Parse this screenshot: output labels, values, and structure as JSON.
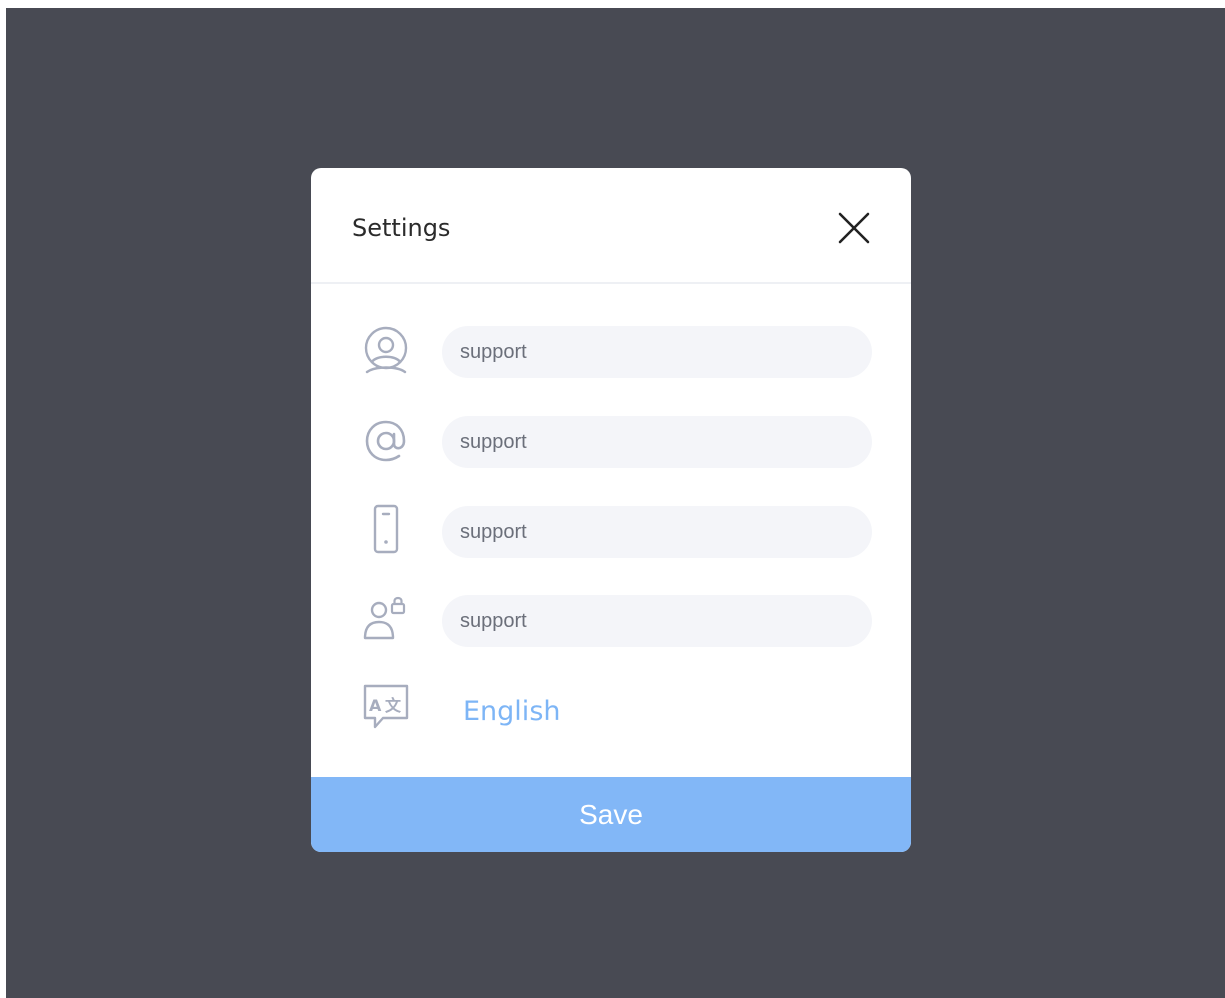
{
  "dialog": {
    "title": "Settings",
    "close_icon": "close-icon"
  },
  "fields": [
    {
      "icon": "user-icon",
      "value": "support"
    },
    {
      "icon": "at-sign-icon",
      "value": "support"
    },
    {
      "icon": "mobile-phone-icon",
      "value": "support"
    },
    {
      "icon": "user-lock-icon",
      "value": "support"
    }
  ],
  "language": {
    "icon": "translate-icon",
    "label": "English"
  },
  "actions": {
    "save_label": "Save"
  },
  "colors": {
    "backdrop": "#484a53",
    "accent": "#82b7f7",
    "link": "#7db5f6",
    "icon": "#a7adbe",
    "field_bg": "#f4f5f9"
  }
}
